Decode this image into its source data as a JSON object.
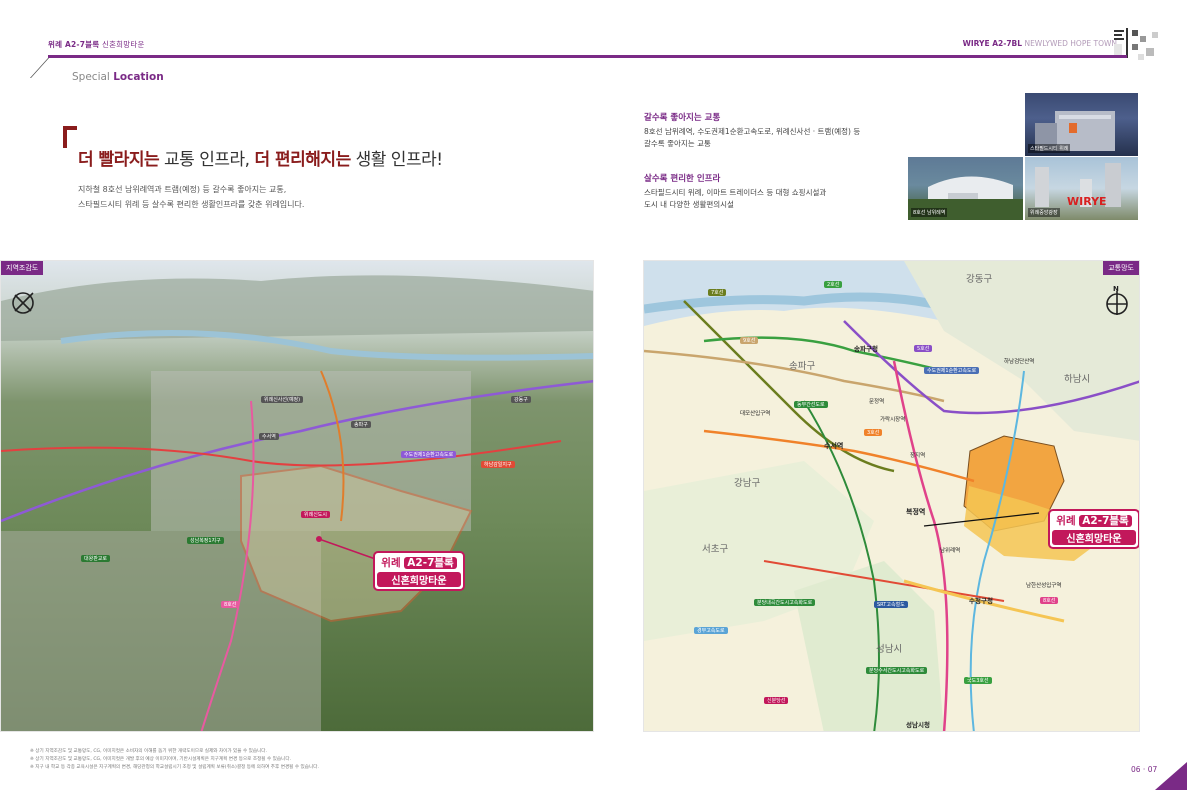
{
  "header": {
    "left_bold": "위례 A2-7블록",
    "left_rest": "신혼희망타운",
    "right_bold": "WIRYE A2-7BL",
    "right_rest": "NEWLYWED HOPE TOWN",
    "logo_text": "위례 신혼희망타운"
  },
  "section": {
    "label_a": "Special",
    "label_b": "Location"
  },
  "headline": {
    "part1": "더 빨라지는",
    "part2": " 교통 인프라, ",
    "part3": "더 편리해지는",
    "part4": " 생활 인프라!"
  },
  "intro": {
    "line1": "지하철 8호선 남위례역과 트램(예정) 등 갈수록 좋아지는 교통,",
    "line2": "스타필드시티 위례 등 살수록 편리한 생활인프라를 갖춘 위례입니다."
  },
  "info": [
    {
      "title": "갈수록 좋아지는 교통",
      "line1": "8호선 남위례역, 수도권제1순환고속도로, 위례신사선 · 트램(예정) 등",
      "line2": "갈수록 좋아지는 교통"
    },
    {
      "title": "살수록 편리한 인프라",
      "line1": "스타필드시티 위례, 이마트 트레이더스 등 대형 쇼핑시설과",
      "line2": "도시 내 다양한 생활편의시설"
    }
  ],
  "photos": [
    {
      "caption": "스타필드시티 위례"
    },
    {
      "caption": "8호선 남위례역"
    },
    {
      "caption": "위례중앙광장"
    }
  ],
  "aerial_map": {
    "tag": "지역조감도",
    "callout_tag": "A2-7블록",
    "callout_pre": "위례",
    "callout_name": "신혼희망타운",
    "labels": {
      "l1": "위례신도시",
      "l2": "성남복정1지구",
      "l3": "수서역",
      "l4": "대왕판교로",
      "l5": "8호선",
      "l6": "수도권제1순환고속도로",
      "l7": "하남감일지구",
      "l8": "위례신사선(예정)",
      "l9": "송파구",
      "l10": "강동구"
    }
  },
  "transit_map": {
    "tag": "교통망도",
    "callout_pre": "위례",
    "callout_tag": "A2-7블록",
    "callout_name": "신혼희망타운",
    "districts": {
      "d1": "강동구",
      "d2": "송파구",
      "d3": "강남구",
      "d4": "서초구",
      "d5": "성남시",
      "d6": "하남시"
    },
    "lines": {
      "b1": "7호선",
      "b2": "2호선",
      "b3": "9호선",
      "b4": "5호선",
      "b5": "3호선",
      "b6": "8호선",
      "b7": "수도권제1순환고속도로",
      "b8": "SRT고속철도",
      "b9": "동부간선도로",
      "b10": "분당수서간도시고속화도로",
      "b11": "신분당선",
      "b12": "국도3호선",
      "b13": "경부고속도로",
      "b14": "분당내곡간도시고속화도로"
    },
    "stations": {
      "s1": "수서역",
      "s2": "복정역",
      "s3": "남위례역",
      "s4": "성남시청",
      "s5": "송파구청",
      "s6": "수정구청",
      "s7": "남한산성입구역",
      "s8": "대모산입구역",
      "s9": "문정역",
      "s10": "장지역",
      "s11": "가락시장역",
      "s12": "하남검단산역"
    },
    "accent_colors": {
      "line8": "#e0428a",
      "line5": "#8a4fc7",
      "line3": "#f0822a",
      "line2": "#39a040",
      "line9": "#c9a56d",
      "line7": "#6b7d1e",
      "route": "#e14a35"
    }
  },
  "notes": {
    "n1": "※ 상기 지역조감도 및 교통망도, CG, 이미지컷은 소비자의 이해를 돕기 위한 개략도이므로 실제와 차이가 있을 수 있습니다.",
    "n2": "※ 상기 지역조감도 및 교통망도, CG, 이미지컷은 개발 후의 예상 이미지이며, 기반시설계획은 지구계획 변경 등으로 조정될 수 있습니다.",
    "n3": "※ 지구 내 학교 등 각종 교육시설은 지구계획의 변경, 해당관청의 학교설립시기 조정 및 설립계획 보류(취소)결정 등에 의하여 추후 변경될 수 있습니다."
  },
  "page_numbers": "06 · 07"
}
